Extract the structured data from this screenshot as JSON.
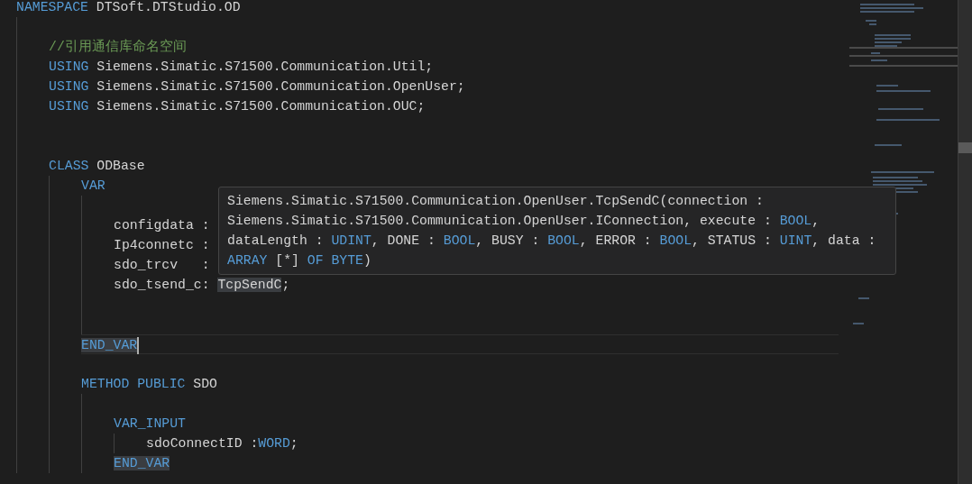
{
  "editor": {
    "lines": [
      {
        "kind": "code",
        "tokens": [
          {
            "kind": "keyword",
            "text": "NAMESPACE"
          },
          {
            "kind": "text",
            "text": " DTSoft.DTStudio.OD"
          }
        ],
        "children": [
          {
            "kind": "blank"
          },
          {
            "kind": "code",
            "tokens": [
              {
                "kind": "comment",
                "text": "//引用通信库命名空间"
              }
            ]
          },
          {
            "kind": "code",
            "tokens": [
              {
                "kind": "keyword",
                "text": "USING"
              },
              {
                "kind": "text",
                "text": " Siemens.Simatic.S71500.Communication.Util;"
              }
            ]
          },
          {
            "kind": "code",
            "tokens": [
              {
                "kind": "keyword",
                "text": "USING"
              },
              {
                "kind": "text",
                "text": " Siemens.Simatic.S71500.Communication.OpenUser;"
              }
            ]
          },
          {
            "kind": "code",
            "tokens": [
              {
                "kind": "keyword",
                "text": "USING"
              },
              {
                "kind": "text",
                "text": " Siemens.Simatic.S71500.Communication.OUC;"
              }
            ]
          },
          {
            "kind": "blank"
          },
          {
            "kind": "blank"
          },
          {
            "kind": "code",
            "tokens": [
              {
                "kind": "keyword",
                "text": "CLASS"
              },
              {
                "kind": "text",
                "text": " ODBase"
              }
            ],
            "children": [
              {
                "kind": "code",
                "tokens": [
                  {
                    "kind": "keyword",
                    "text": "VAR"
                  }
                ],
                "children": [
                  {
                    "kind": "blank"
                  },
                  {
                    "kind": "code",
                    "tokens": [
                      {
                        "kind": "text",
                        "text": "configdata :"
                      }
                    ]
                  },
                  {
                    "kind": "code",
                    "tokens": [
                      {
                        "kind": "text",
                        "text": "Ip4connetc :"
                      }
                    ]
                  },
                  {
                    "kind": "code",
                    "tokens": [
                      {
                        "kind": "text",
                        "text": "sdo_trcv   :"
                      }
                    ]
                  },
                  {
                    "kind": "code",
                    "tokens": [
                      {
                        "kind": "text",
                        "text": "sdo_tsend_c: "
                      },
                      {
                        "kind": "text",
                        "text": "TcpSendC",
                        "highlighted": true
                      },
                      {
                        "kind": "text",
                        "text": ";"
                      }
                    ]
                  },
                  {
                    "kind": "blank"
                  },
                  {
                    "kind": "blank"
                  }
                ]
              },
              {
                "kind": "code",
                "current": true,
                "tokens": [
                  {
                    "kind": "keyword",
                    "text": "END_VAR",
                    "highlighted": true
                  }
                ]
              },
              {
                "kind": "blank"
              },
              {
                "kind": "code",
                "tokens": [
                  {
                    "kind": "keyword",
                    "text": "METHOD PUBLIC"
                  },
                  {
                    "kind": "text",
                    "text": " SDO"
                  }
                ],
                "children": [
                  {
                    "kind": "blank"
                  },
                  {
                    "kind": "code",
                    "tokens": [
                      {
                        "kind": "keyword",
                        "text": "VAR_INPUT"
                      }
                    ],
                    "children": [
                      {
                        "kind": "code",
                        "tokens": [
                          {
                            "kind": "text",
                            "text": "sdoConnectID :"
                          },
                          {
                            "kind": "keyword",
                            "text": "WORD"
                          },
                          {
                            "kind": "text",
                            "text": ";"
                          }
                        ]
                      }
                    ]
                  },
                  {
                    "kind": "code",
                    "tokens": [
                      {
                        "kind": "keyword",
                        "text": "END_VAR",
                        "highlighted": true
                      }
                    ]
                  }
                ]
              }
            ]
          }
        ]
      }
    ]
  },
  "tooltip": {
    "lines": [
      [
        {
          "kind": "text",
          "text": "Siemens.Simatic.S71500.Communication.OpenUser.TcpSendC(connection :"
        }
      ],
      [
        {
          "kind": "text",
          "text": "Siemens.Simatic.S71500.Communication.OpenUser.IConnection, execute : "
        },
        {
          "kind": "keyword",
          "text": "BOOL"
        },
        {
          "kind": "text",
          "text": ","
        }
      ],
      [
        {
          "kind": "text",
          "text": "dataLength : "
        },
        {
          "kind": "keyword",
          "text": "UDINT"
        },
        {
          "kind": "text",
          "text": ", DONE : "
        },
        {
          "kind": "keyword",
          "text": "BOOL"
        },
        {
          "kind": "text",
          "text": ", BUSY : "
        },
        {
          "kind": "keyword",
          "text": "BOOL"
        },
        {
          "kind": "text",
          "text": ", ERROR : "
        },
        {
          "kind": "keyword",
          "text": "BOOL"
        },
        {
          "kind": "text",
          "text": ", STATUS : "
        },
        {
          "kind": "keyword",
          "text": "UINT"
        },
        {
          "kind": "text",
          "text": ", data :"
        }
      ],
      [
        {
          "kind": "keyword",
          "text": "ARRAY"
        },
        {
          "kind": "text",
          "text": " [*] "
        },
        {
          "kind": "keyword",
          "text": "OF BYTE"
        },
        {
          "kind": "text",
          "text": ")"
        }
      ]
    ]
  }
}
